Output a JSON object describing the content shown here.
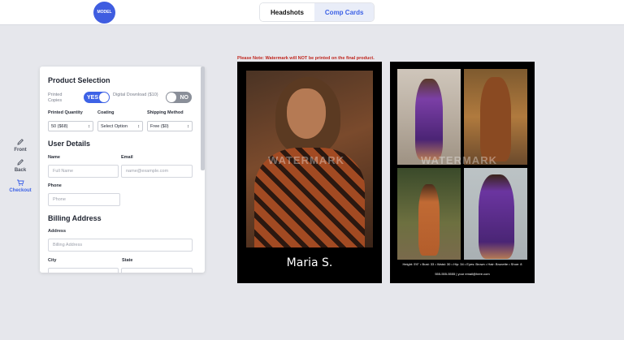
{
  "header": {
    "logo_text": "MODEL",
    "tabs": [
      {
        "label": "Headshots",
        "active": true
      },
      {
        "label": "Comp Cards",
        "active": false
      }
    ]
  },
  "sidenav": {
    "items": [
      {
        "label": "Front",
        "icon": "pencil-icon",
        "active": false
      },
      {
        "label": "Back",
        "icon": "pencil-icon",
        "active": false
      },
      {
        "label": "Checkout",
        "icon": "cart-icon",
        "active": true
      }
    ]
  },
  "panel": {
    "product_title": "Product Selection",
    "printed_copies_label": "Printed Copies",
    "printed_toggle": "YES",
    "digital_label": "Digital Download ($10)",
    "digital_toggle": "NO",
    "quantity_label": "Printed Quantity",
    "quantity_value": "50 ($68)",
    "coating_label": "Coating",
    "coating_value": "Select Option",
    "shipping_label": "Shipping Method",
    "shipping_value": "Free ($0)",
    "user_title": "User Details",
    "name_label": "Name",
    "name_placeholder": "Full Name",
    "email_label": "Email",
    "email_placeholder": "name@example.com",
    "phone_label": "Phone",
    "phone_placeholder": "Phone",
    "billing_title": "Billing Address",
    "address_label": "Address",
    "address_placeholder": "Billing Address",
    "city_label": "City",
    "state_label": "State"
  },
  "preview": {
    "note": "Please Note: Watermark will NOT be printed on the final product.",
    "watermark": "WATERMARK",
    "model_name": "Maria S.",
    "stats": "Height: 5'6\" • Bust: 33 • Waist: 30 • Hip: 34 • Eyes: Brown • Hair: Brunette • Shoe: 8",
    "contact": "555-555-5555 | your email@here.com"
  },
  "colors": {
    "accent": "#3d62e6",
    "note_red": "#c0271f"
  }
}
